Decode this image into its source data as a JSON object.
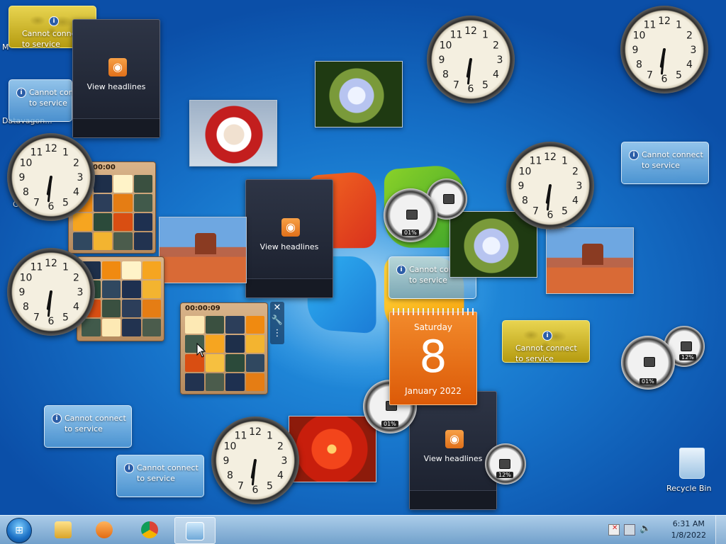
{
  "desktop": {
    "partial_icon_labels": [
      "M",
      "Datavagon...",
      "C"
    ],
    "recycle_bin_label": "Recycle Bin"
  },
  "weather": {
    "message_line1": "Cannot connect",
    "message_line2": "to service",
    "info_glyph": "i"
  },
  "feed": {
    "label": "View headlines",
    "icon": "rss-icon"
  },
  "puzzle": {
    "time_top": "00:00",
    "time_main": "00:00:09"
  },
  "cpu_meter": {
    "cpu_percent": "01%",
    "memory_percent": "12%"
  },
  "calendar": {
    "weekday": "Saturday",
    "day": "8",
    "month_year": "January 2022"
  },
  "gadget_toolbar": {
    "close_glyph": "✕",
    "options_glyph": "🔧",
    "drag_glyph": "⋮"
  },
  "taskbar": {
    "start_glyph": "⊞",
    "pinned": [
      "explorer-icon",
      "media-player-icon",
      "chrome-icon",
      "gadgets-icon"
    ],
    "clock_time": "6:31 AM",
    "clock_date": "1/8/2022"
  },
  "clocks": {
    "hour_hand_angle": 190,
    "minute_hand_angle": 186
  },
  "colors": {
    "desktop_blue": "#1672c9",
    "calendar_orange": "#dc5a08",
    "taskbar": "#9fc2e0"
  }
}
